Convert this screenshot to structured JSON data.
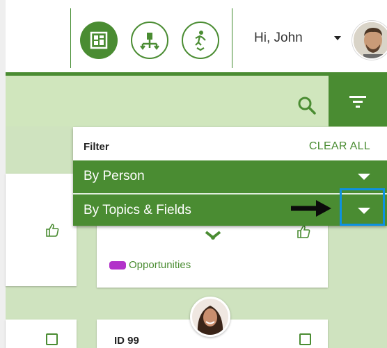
{
  "header": {
    "greeting": "Hi, John",
    "buttons": [
      {
        "icon": "board-view-icon",
        "state": "active"
      },
      {
        "icon": "network-icon",
        "state": "inactive"
      },
      {
        "icon": "person-activity-icon",
        "state": "inactive"
      }
    ]
  },
  "search": {
    "icon": "search-icon",
    "filter_icon": "filter-icon"
  },
  "filter": {
    "title": "Filter",
    "clear_all": "CLEAR ALL",
    "rows": [
      {
        "label": "By Person"
      },
      {
        "label": "By Topics & Fields"
      }
    ]
  },
  "cards": {
    "tag_label": "Opportunities",
    "id_label": "ID 99"
  },
  "colors": {
    "brand_green": "#4a8c32",
    "light_green": "#cfe3bf",
    "tag_purple": "#b232c9",
    "highlight_blue": "#0d91e1"
  }
}
